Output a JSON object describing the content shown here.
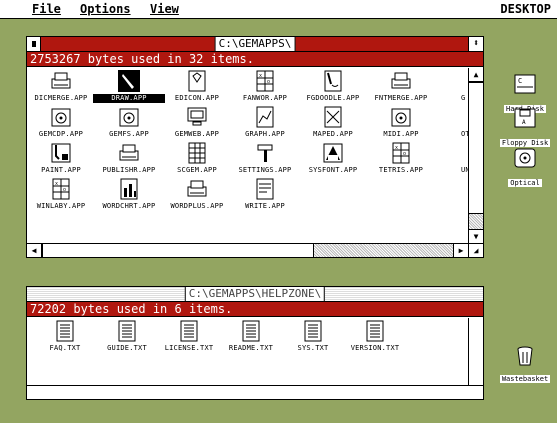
{
  "menubar": {
    "items": [
      {
        "label": "File"
      },
      {
        "label": "Options"
      },
      {
        "label": "View"
      }
    ],
    "right_label": "DESKTOP"
  },
  "desktop_icons": [
    {
      "label": "Hard Disk",
      "icon": "hard-disk-icon"
    },
    {
      "label": "Floppy Disk",
      "icon": "floppy-disk-icon"
    },
    {
      "label": "Optical",
      "icon": "optical-disc-icon"
    },
    {
      "label": "Wastebasket",
      "icon": "wastebasket-icon"
    }
  ],
  "window1": {
    "title": "C:\\GEMAPPS\\",
    "info": "2753267 bytes used in 32 items.",
    "full_glyph": "⬍",
    "files": [
      {
        "label": "DICMERGE.APP",
        "icon": "printer-doc-icon"
      },
      {
        "label": "DRAW.APP",
        "icon": "draw-app-icon",
        "selected": true
      },
      {
        "label": "EDICON.APP",
        "icon": "icon-editor-icon"
      },
      {
        "label": "FANWOR.APP",
        "icon": "grid-app-icon"
      },
      {
        "label": "FGDOODLE.APP",
        "icon": "pen-app-icon"
      },
      {
        "label": "FNTMERGE.APP",
        "icon": "printer-doc-icon"
      },
      {
        "label": "G",
        "icon": ""
      },
      {
        "label": "GEMCDP.APP",
        "icon": "disc-app-icon"
      },
      {
        "label": "GEMFS.APP",
        "icon": "disc-app-icon"
      },
      {
        "label": "GEMWEB.APP",
        "icon": "monitor-app-icon"
      },
      {
        "label": "GRAPH.APP",
        "icon": "graph-app-icon"
      },
      {
        "label": "MAPED.APP",
        "icon": "map-app-icon"
      },
      {
        "label": "MIDI.APP",
        "icon": "disc-app-icon"
      },
      {
        "label": "OTH",
        "icon": ""
      },
      {
        "label": "PAINT.APP",
        "icon": "paint-app-icon"
      },
      {
        "label": "PUBLISHR.APP",
        "icon": "printer-doc-icon"
      },
      {
        "label": "SCGEM.APP",
        "icon": "spreadsheet-app-icon"
      },
      {
        "label": "SETTINGS.APP",
        "icon": "hammer-app-icon"
      },
      {
        "label": "SYSFONT.APP",
        "icon": "font-app-icon"
      },
      {
        "label": "TETRIS.APP",
        "icon": "grid-app-icon"
      },
      {
        "label": "UN",
        "icon": ""
      },
      {
        "label": "WINLABY.APP",
        "icon": "grid-app-icon"
      },
      {
        "label": "WORDCHRT.APP",
        "icon": "chart-app-icon"
      },
      {
        "label": "WORDPLUS.APP",
        "icon": "printer-doc-icon"
      },
      {
        "label": "WRITE.APP",
        "icon": "write-app-icon"
      }
    ]
  },
  "window2": {
    "title": "C:\\GEMAPPS\\HELPZONE\\",
    "info": "72202 bytes used in 6 items.",
    "files": [
      {
        "label": "FAQ.TXT",
        "icon": "text-file-icon"
      },
      {
        "label": "GUIDE.TXT",
        "icon": "text-file-icon"
      },
      {
        "label": "LICENSE.TXT",
        "icon": "text-file-icon"
      },
      {
        "label": "README.TXT",
        "icon": "text-file-icon"
      },
      {
        "label": "SYS.TXT",
        "icon": "text-file-icon"
      },
      {
        "label": "VERSION.TXT",
        "icon": "text-file-icon"
      }
    ]
  },
  "colors": {
    "desktop": "#93a561",
    "title_active": "#b0170f"
  }
}
